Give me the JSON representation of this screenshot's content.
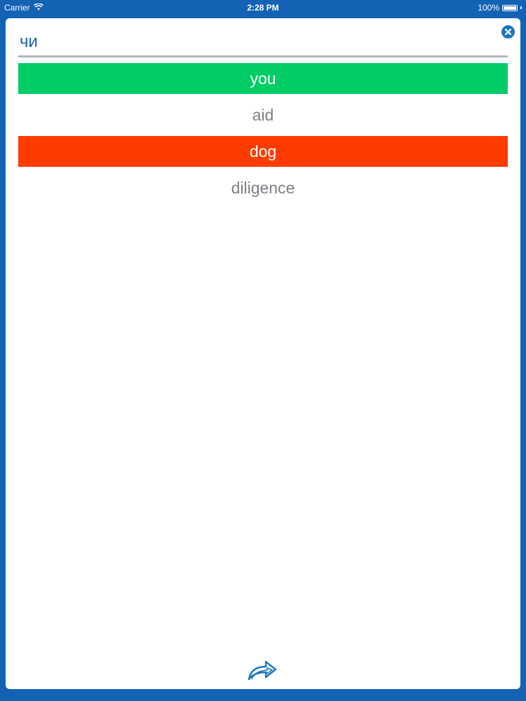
{
  "status_bar": {
    "carrier": "Carrier",
    "time": "2:28 PM",
    "battery": "100%",
    "battery_level": 1.0
  },
  "quiz": {
    "word": "чи",
    "options": [
      {
        "label": "you",
        "state": "correct"
      },
      {
        "label": "aid",
        "state": "neutral"
      },
      {
        "label": "dog",
        "state": "wrong"
      },
      {
        "label": "diligence",
        "state": "neutral"
      }
    ]
  },
  "icons": {
    "close": "close-icon",
    "next": "forward-arrow-icon",
    "wifi": "wifi-icon"
  },
  "colors": {
    "frame": "#1462b4",
    "correct": "#00cc66",
    "wrong": "#ff3c00",
    "word": "#1c5fa5"
  }
}
